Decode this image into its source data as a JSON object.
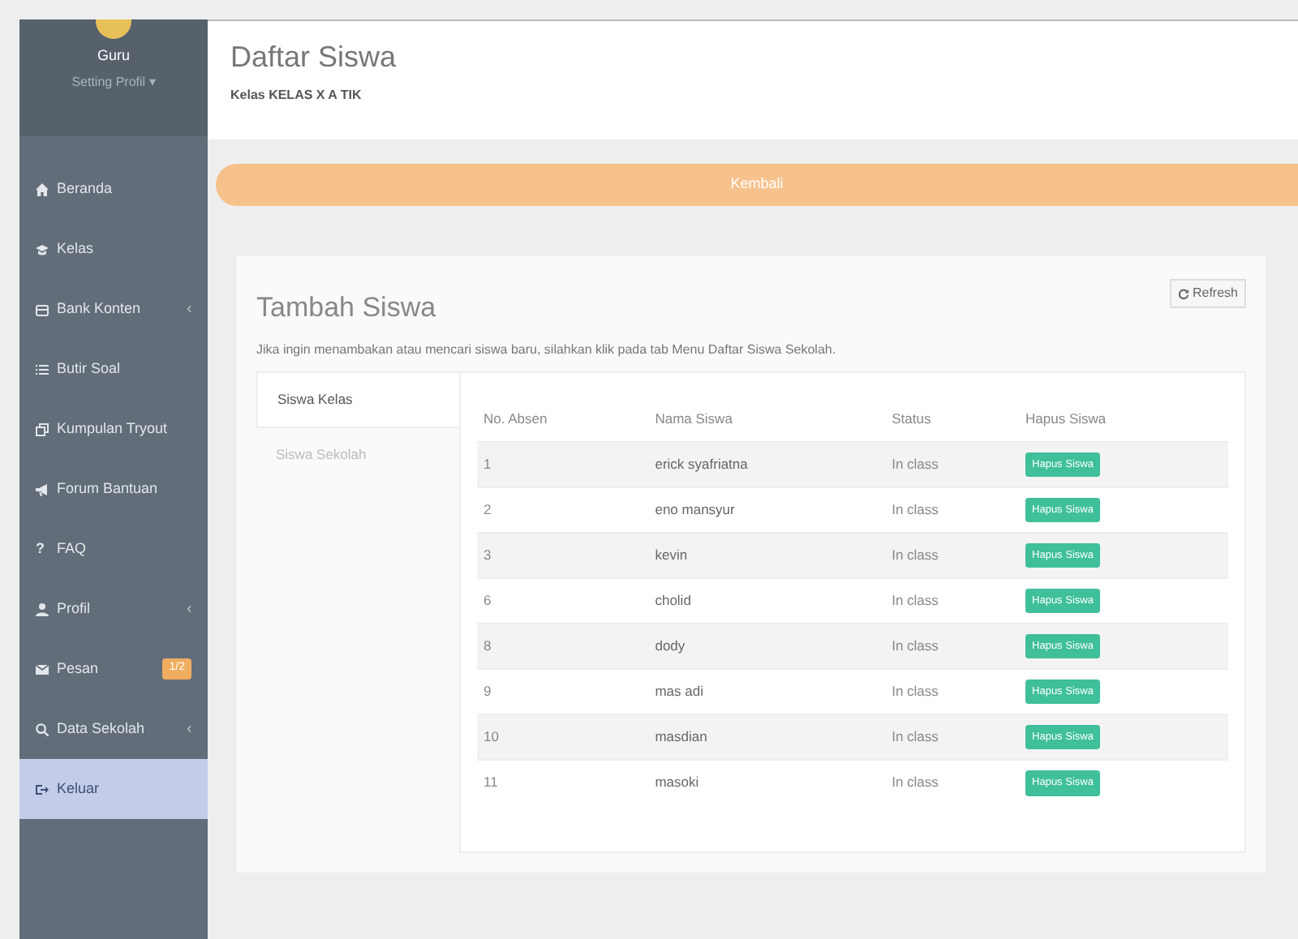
{
  "sidebar": {
    "user": {
      "name": "Guru",
      "menu": "Setting Profil ▾"
    },
    "items": [
      {
        "label": "Beranda",
        "selected": false
      },
      {
        "label": "Kelas",
        "selected": false
      },
      {
        "label": "Bank Konten",
        "expandable": true,
        "selected": false
      },
      {
        "label": "Butir Soal",
        "selected": false
      },
      {
        "label": "Kumpulan Tryout",
        "selected": false
      },
      {
        "label": "Forum Bantuan",
        "selected": false
      },
      {
        "label": "FAQ",
        "glyph": "?",
        "selected": false
      },
      {
        "label": "Profil",
        "expandable": true,
        "selected": false
      },
      {
        "label": "Pesan",
        "badge": "1/2",
        "selected": false
      },
      {
        "label": "Data Sekolah",
        "expandable": true,
        "selected": false
      },
      {
        "label": "Keluar",
        "selected": true
      }
    ]
  },
  "header": {
    "title": "Daftar Siswa",
    "subtitle": "Kelas KELAS X A TIK"
  },
  "back_button": "Kembali",
  "panel": {
    "title": "Tambah Siswa",
    "refresh_button": "Refresh",
    "description": "Jika ingin menambakan atau mencari siswa baru, silahkan klik pada tab Menu Daftar Siswa Sekolah.",
    "tabs": [
      {
        "label": "Siswa Kelas",
        "selected": true
      },
      {
        "label": "Siswa Sekolah",
        "selected": false
      }
    ],
    "table": {
      "columns": [
        "No. Absen",
        "Nama Siswa",
        "Status",
        "Hapus Siswa"
      ],
      "rows": [
        {
          "no": "1",
          "name": "erick syafriatna",
          "status": "In class",
          "action": "Hapus Siswa"
        },
        {
          "no": "2",
          "name": "eno mansyur",
          "status": "In class",
          "action": "Hapus Siswa"
        },
        {
          "no": "3",
          "name": "kevin",
          "status": "In class",
          "action": "Hapus Siswa"
        },
        {
          "no": "6",
          "name": "cholid",
          "status": "In class",
          "action": "Hapus Siswa"
        },
        {
          "no": "8",
          "name": "dody",
          "status": "In class",
          "action": "Hapus Siswa"
        },
        {
          "no": "9",
          "name": "mas adi",
          "status": "In class",
          "action": "Hapus Siswa"
        },
        {
          "no": "10",
          "name": "masdian",
          "status": "In class",
          "action": "Hapus Siswa"
        },
        {
          "no": "11",
          "name": "masoki",
          "status": "In class",
          "action": "Hapus Siswa"
        }
      ]
    }
  }
}
